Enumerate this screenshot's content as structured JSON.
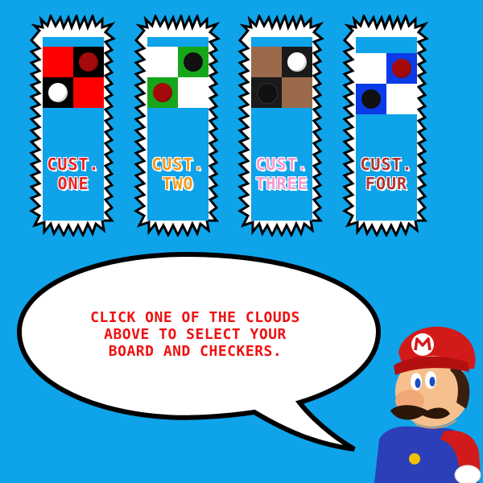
{
  "cards": [
    {
      "line1": "CUST.",
      "line2": "ONE",
      "label_color": "#ee2222",
      "board": {
        "dark": "#000000",
        "light": "#ff0000",
        "pieces": [
          "dark-red-checker",
          "white-checker"
        ]
      }
    },
    {
      "line1": "CUST.",
      "line2": "TWO",
      "label_color": "#f39a1d",
      "board": {
        "dark": "#16a61a",
        "light": "#ffffff",
        "pieces": [
          "black-checker",
          "dark-red-checker"
        ]
      }
    },
    {
      "line1": "CUST.",
      "line2": "THREE",
      "label_color": "#f79ad0",
      "board": {
        "dark": "#1a1a1a",
        "light": "#9a6a4a",
        "pieces": [
          "white-checker",
          "black-checker"
        ]
      }
    },
    {
      "line1": "CUST.",
      "line2": "FOUR",
      "label_color": "#b3332e",
      "board": {
        "dark": "#0a3be6",
        "light": "#ffffff",
        "pieces": [
          "dark-red-checker",
          "black-checker"
        ]
      }
    }
  ],
  "speech": {
    "line1": "CLICK ONE OF THE CLOUDS",
    "line2": "ABOVE TO SELECT YOUR",
    "line3": "BOARD AND CHECKERS."
  },
  "colors": {
    "background": "#0fa3ea",
    "speech_text": "#ee1111"
  }
}
